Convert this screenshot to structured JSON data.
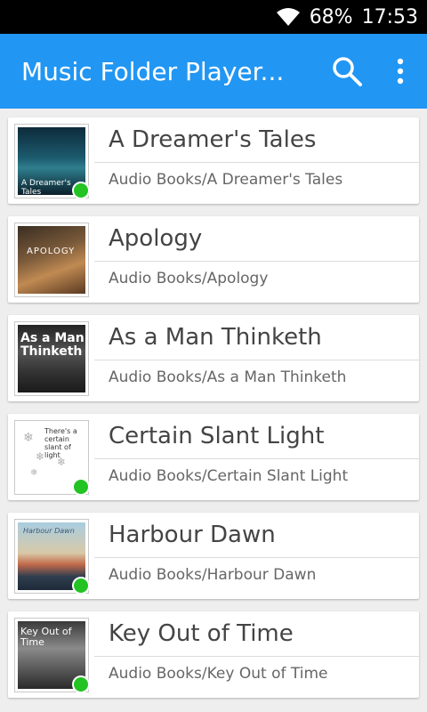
{
  "status": {
    "battery": "68%",
    "time": "17:53"
  },
  "app_bar": {
    "title": "Music Folder Player..."
  },
  "items": [
    {
      "title": "A Dreamer's Tales",
      "path": "Audio Books/A Dreamer's Tales",
      "art_text": "A Dreamer's Tales",
      "played": true
    },
    {
      "title": "Apology",
      "path": "Audio Books/Apology",
      "art_text": "APOLOGY",
      "played": false
    },
    {
      "title": "As a Man Thinketh",
      "path": "Audio Books/As a Man Thinketh",
      "art_text": "As a Man Thinketh",
      "played": false
    },
    {
      "title": "Certain Slant Light",
      "path": "Audio Books/Certain Slant Light",
      "art_text": "There's a certain slant of light",
      "played": true
    },
    {
      "title": "Harbour Dawn",
      "path": "Audio Books/Harbour Dawn",
      "art_text": "Harbour Dawn",
      "played": true
    },
    {
      "title": "Key Out of Time",
      "path": "Audio Books/Key Out of Time",
      "art_text": "Key Out of Time",
      "played": true
    }
  ],
  "colors": {
    "app_bar": "#2196f3",
    "played_dot": "#22c322"
  }
}
